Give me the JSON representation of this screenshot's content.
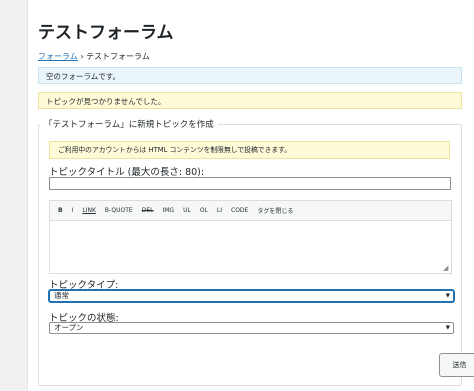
{
  "page_title": "テストフォーラム",
  "breadcrumb": {
    "link": "フォーラム",
    "separator": "›",
    "current": "テストフォーラム"
  },
  "notices": {
    "info": "空のフォーラムです。",
    "warning": "トピックが見つかりませんでした。"
  },
  "form": {
    "legend": "「テストフォーラム」に新規トピックを作成",
    "html_warning": "ご利用中のアカウントからは HTML コンテンツを制限無しで投稿できます。",
    "title_label": "トピックタイトル (最大の長さ: 80):",
    "title_value": "",
    "toolbar": [
      "B",
      "I",
      "LINK",
      "B-QUOTE",
      "DEL",
      "IMG",
      "UL",
      "OL",
      "LI",
      "CODE",
      "タグを閉じる"
    ],
    "content_value": "",
    "type_label": "トピックタイプ:",
    "type_selected": "通常",
    "status_label": "トピックの状態:",
    "status_selected": "オープン",
    "submit_label": "送信"
  },
  "icons": {
    "dropdown": "chevron-down-icon",
    "resize": "resize-handle-icon"
  },
  "colors": {
    "link": "#2271b1",
    "info_bg": "#eaf6fb",
    "warning_bg": "#fffbd9",
    "focus": "#2271b1"
  }
}
